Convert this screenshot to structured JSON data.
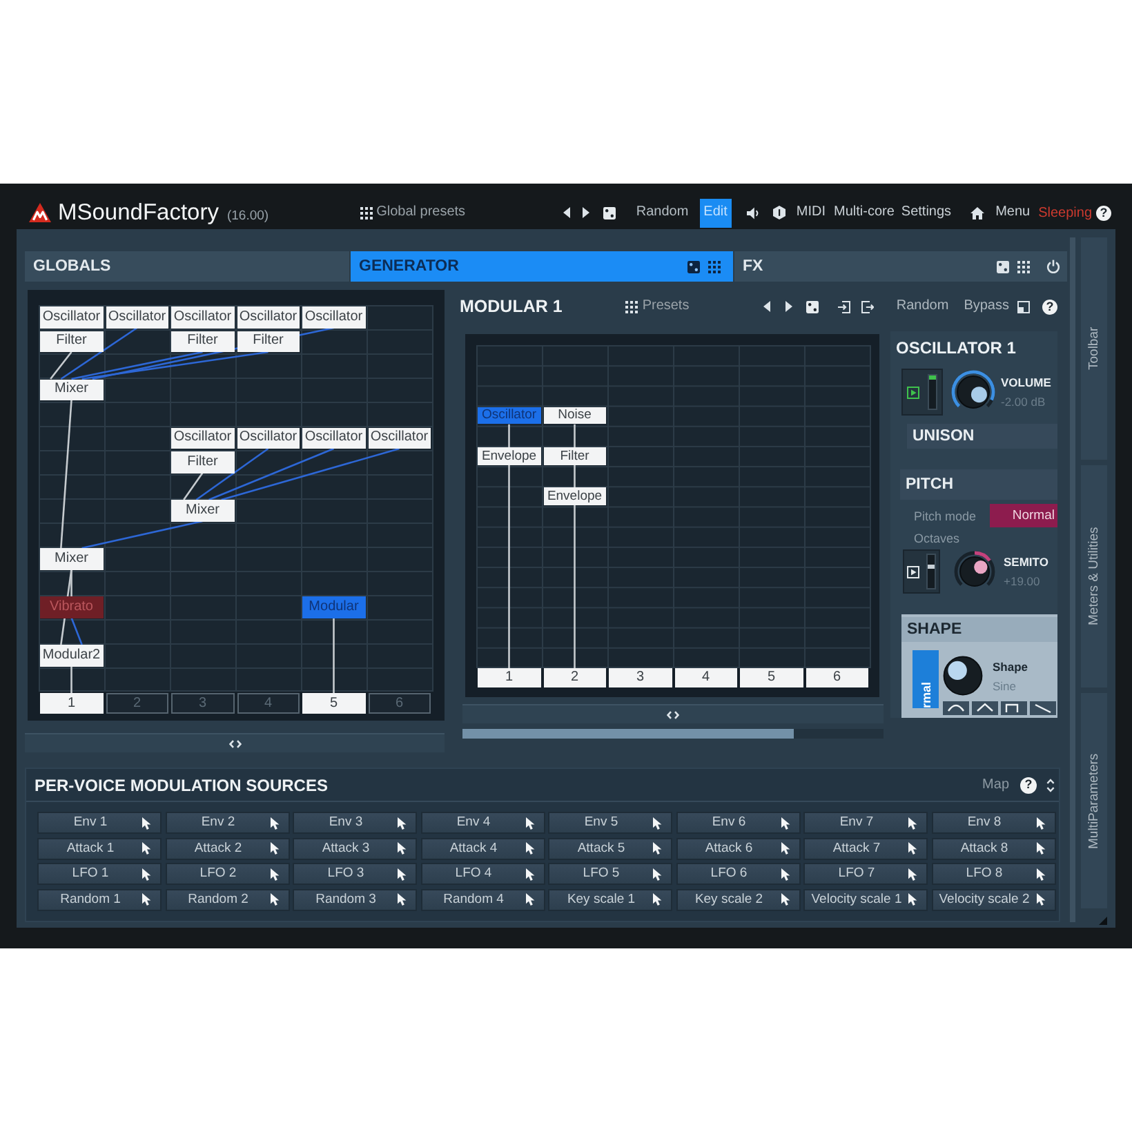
{
  "top_bar": {
    "title": "MSoundFactory",
    "version": "(16.00)",
    "presets": "Global presets",
    "random": "Random",
    "edit": {
      "label": "Edit",
      "on": true
    },
    "midi": "MIDI",
    "multi_core": "Multi-core",
    "settings": "Settings",
    "menu": "Menu",
    "status": {
      "label": "Sleeping",
      "on": true
    },
    "help": "?"
  },
  "sections": [
    {
      "label": "GLOBALS",
      "kind": "plain",
      "selected": false
    },
    {
      "label": "GENERATOR",
      "kind": "presets",
      "selected": true
    },
    {
      "label": "FX",
      "kind": "switchable",
      "selected": false
    }
  ],
  "globals": {
    "rows": [
      [
        {
          "label": "Oscillator",
          "selected": false,
          "disabled": false
        },
        {
          "label": "Oscillator",
          "selected": false,
          "disabled": false
        },
        {
          "label": "Oscillator",
          "selected": false,
          "disabled": false
        },
        {
          "label": "Oscillator",
          "selected": false,
          "disabled": false
        },
        {
          "label": "Oscillator",
          "selected": false,
          "disabled": false
        },
        null
      ],
      [
        {
          "label": "Filter",
          "selected": false,
          "disabled": false
        },
        null,
        {
          "label": "Filter",
          "selected": false,
          "disabled": false
        },
        {
          "label": "Filter",
          "selected": false,
          "disabled": false
        },
        null,
        null
      ],
      [
        null,
        null,
        null,
        null,
        null,
        null
      ],
      [
        {
          "label": "Mixer",
          "selected": false,
          "disabled": false
        },
        null,
        null,
        null,
        null,
        null
      ],
      [
        null,
        null,
        null,
        null,
        null,
        null
      ],
      [
        null,
        null,
        {
          "label": "Oscillator",
          "selected": false,
          "disabled": false
        },
        {
          "label": "Oscillator",
          "selected": false,
          "disabled": false
        },
        {
          "label": "Oscillator",
          "selected": false,
          "disabled": false
        },
        {
          "label": "Oscillator",
          "selected": false,
          "disabled": false
        }
      ],
      [
        null,
        null,
        {
          "label": "Filter",
          "selected": false,
          "disabled": false
        },
        null,
        null,
        null
      ],
      [
        null,
        null,
        null,
        null,
        null,
        null
      ],
      [
        null,
        null,
        {
          "label": "Mixer",
          "selected": false,
          "disabled": false
        },
        null,
        null,
        null
      ],
      [
        null,
        null,
        null,
        null,
        null,
        null
      ],
      [
        {
          "label": "Mixer",
          "selected": false,
          "disabled": false
        },
        null,
        null,
        null,
        null,
        null
      ],
      [
        null,
        null,
        null,
        null,
        null,
        null
      ],
      [
        {
          "label": "Vibrato",
          "selected": false,
          "disabled": true
        },
        null,
        null,
        null,
        {
          "label": "Modular",
          "selected": true,
          "disabled": false
        },
        null
      ],
      [
        null,
        null,
        null,
        null,
        null,
        null
      ],
      [
        {
          "label": "Modular2",
          "selected": false,
          "disabled": false
        },
        null,
        null,
        null,
        null,
        null
      ],
      [
        null,
        null,
        null,
        null,
        null,
        null
      ]
    ],
    "outputs": [
      {
        "label": "1",
        "active": true
      },
      {
        "label": "2",
        "active": false
      },
      {
        "label": "3",
        "active": false
      },
      {
        "label": "4",
        "active": false
      },
      {
        "label": "5",
        "active": true
      },
      {
        "label": "6",
        "active": false
      }
    ]
  },
  "modular": {
    "title": "MODULAR 1",
    "presets": "Presets",
    "random": "Random",
    "bypass": "Bypass",
    "help": "?",
    "rows": [
      [
        null,
        null,
        null,
        null,
        null,
        null
      ],
      [
        null,
        null,
        null,
        null,
        null,
        null
      ],
      [
        null,
        null,
        null,
        null,
        null,
        null
      ],
      [
        {
          "label": "Oscillator",
          "selected": true,
          "disabled": false
        },
        {
          "label": "Noise",
          "selected": false,
          "disabled": false
        },
        null,
        null,
        null,
        null
      ],
      [
        null,
        null,
        null,
        null,
        null,
        null
      ],
      [
        {
          "label": "Envelope",
          "selected": false,
          "disabled": false
        },
        {
          "label": "Filter",
          "selected": false,
          "disabled": false
        },
        null,
        null,
        null,
        null
      ],
      [
        null,
        null,
        null,
        null,
        null,
        null
      ],
      [
        null,
        {
          "label": "Envelope",
          "selected": false,
          "disabled": false
        },
        null,
        null,
        null,
        null
      ],
      [
        null,
        null,
        null,
        null,
        null,
        null
      ],
      [
        null,
        null,
        null,
        null,
        null,
        null
      ],
      [
        null,
        null,
        null,
        null,
        null,
        null
      ],
      [
        null,
        null,
        null,
        null,
        null,
        null
      ],
      [
        null,
        null,
        null,
        null,
        null,
        null
      ],
      [
        null,
        null,
        null,
        null,
        null,
        null
      ],
      [
        null,
        null,
        null,
        null,
        null,
        null
      ],
      [
        null,
        null,
        null,
        null,
        null,
        null
      ]
    ],
    "outputs": [
      {
        "label": "1",
        "active": true
      },
      {
        "label": "2",
        "active": true
      },
      {
        "label": "3",
        "active": true
      },
      {
        "label": "4",
        "active": true
      },
      {
        "label": "5",
        "active": true
      },
      {
        "label": "6",
        "active": true
      }
    ]
  },
  "oscillator": {
    "title": "OSCILLATOR 1",
    "volume": {
      "toggle": {
        "on": true
      },
      "fader": {
        "level": 1
      },
      "knob": {
        "kind": "unipolar",
        "level": 0.92
      },
      "label": "VOLUME",
      "reading": "-2.00 dB"
    },
    "unison": {
      "title": "UNISON"
    },
    "pitch": {
      "title": "PITCH",
      "mode": {
        "label": "Pitch mode",
        "value": "Normal"
      },
      "octaves": {
        "label": "Octaves",
        "toggle": {
          "on": false
        },
        "fader": {
          "level": 0.65
        }
      },
      "semitones": {
        "knob": {
          "kind": "bipolar",
          "level": 0.7
        },
        "label": "SEMITO",
        "reading": "+19.00"
      }
    },
    "shape": {
      "title": "SHAPE",
      "mode_tab": "rmal",
      "knob": {
        "kind": "stepped",
        "level": 0.33
      },
      "label": "Shape",
      "reading": "Sine"
    }
  },
  "mod_sources": {
    "title": "PER-VOICE MODULATION SOURCES",
    "map": "Map",
    "help": "?",
    "items": [
      "Env 1",
      "Env 2",
      "Env 3",
      "Env 4",
      "Env 5",
      "Env 6",
      "Env 7",
      "Env 8",
      "Attack 1",
      "Attack 2",
      "Attack 3",
      "Attack 4",
      "Attack 5",
      "Attack 6",
      "Attack 7",
      "Attack 8",
      "LFO 1",
      "LFO 2",
      "LFO 3",
      "LFO 4",
      "LFO 5",
      "LFO 6",
      "LFO 7",
      "LFO 8",
      "Random 1",
      "Random 2",
      "Random 3",
      "Random 4",
      "Key scale 1",
      "Key scale 2",
      "Velocity scale 1",
      "Velocity scale 2"
    ]
  },
  "side_panels": [
    "Toolbar",
    "Meters & Utilities",
    "MultiParameters"
  ]
}
